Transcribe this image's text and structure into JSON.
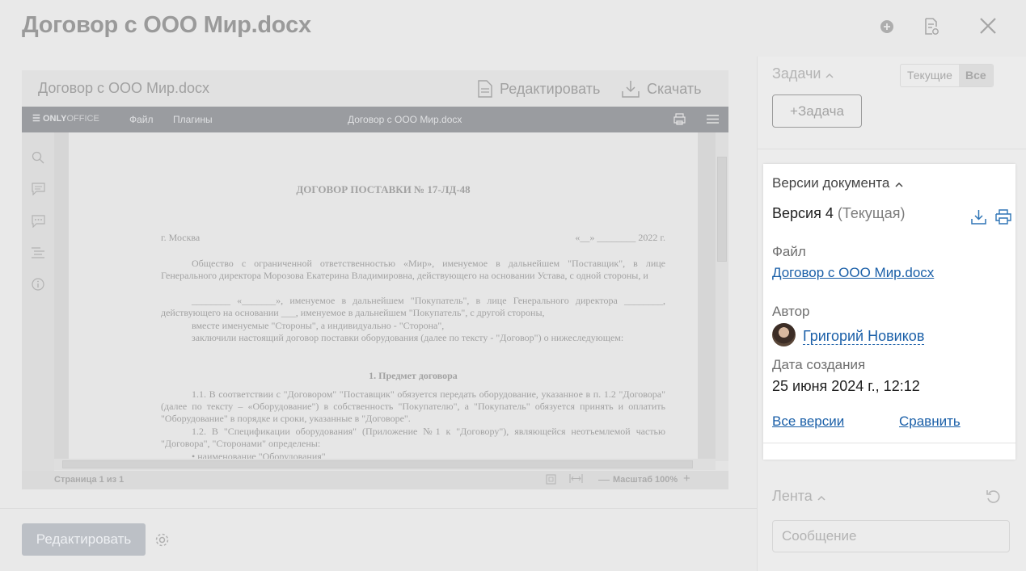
{
  "window": {
    "title": "Договор с ООО Мир.docx",
    "header_icons": [
      "add-circle-icon",
      "document-settings-icon",
      "close-icon"
    ]
  },
  "document_card": {
    "title": "Договор с ООО Мир.docx",
    "edit_label": "Редактировать",
    "download_label": "Скачать"
  },
  "editor": {
    "brand_bold": "ONLY",
    "brand_light": "OFFICE",
    "menu": [
      "Файл",
      "Плагины"
    ],
    "doc_name": "Договор с ООО Мир.docx",
    "status_page": "Страница 1 из 1",
    "zoom_label": "Масштаб 100%"
  },
  "page": {
    "title": "ДОГОВОР ПОСТАВКИ № 17-ЛД-48",
    "city": "г. Москва",
    "date": "«__» ________ 2022 г.",
    "para1": "Общество с ограниченной ответственностью «Мир», именуемое в дальнейшем \"Поставщик\", в лице Генерального директора Морозова Екатерина Владимировна, действующего на основании Устава, с одной стороны, и",
    "para2": "________ «_______», именуемое в дальнейшем \"Покупатель\", в лице Генерального директора ________, действующего на основании ___, именуемое в дальнейшем \"Покупатель\", с другой стороны,",
    "para3": "вместе именуемые \"Стороны\", а индивидуально - \"Сторона\",",
    "para4": "заключили настоящий договор поставки оборудования (далее по тексту - \"Договор\") о нижеследующем:",
    "section1": "1. Предмет договора",
    "clause11": "1.1. В соответствии с \"Договором\" \"Поставщик\" обязуется передать оборудование, указанное в п. 1.2 \"Договора\" (далее по тексту – «Оборудование\") в собственность \"Покупателю\", а \"Покупатель\" обязуется принять и оплатить \"Оборудование\" в порядке и сроки, указанные в \"Договоре\".",
    "clause12": "1.2. В \"Спецификации оборудования\" (Приложение №1 к \"Договору\"), являющейся неотъемлемой частью \"Договора\", \"Сторонами\" определены:",
    "bullet1": "•    наименование \"Оборудования\""
  },
  "footer": {
    "edit_button": "Редактировать"
  },
  "tasks": {
    "title": "Задачи",
    "filter_current": "Текущие",
    "filter_all": "Все",
    "add_button": "+Задача"
  },
  "versions": {
    "title": "Версии документа",
    "version_label": "Версия 4",
    "version_status": "(Текущая)",
    "file_label": "Файл",
    "file_name": "Договор с ООО Мир.docx",
    "author_label": "Автор",
    "author_name": "Григорий Новиков",
    "date_label": "Дата создания",
    "date_value": "25 июня 2024 г., 12:12",
    "all_versions": "Все версии",
    "compare": "Сравнить"
  },
  "feed": {
    "title": "Лента",
    "message_placeholder": "Сообщение"
  }
}
